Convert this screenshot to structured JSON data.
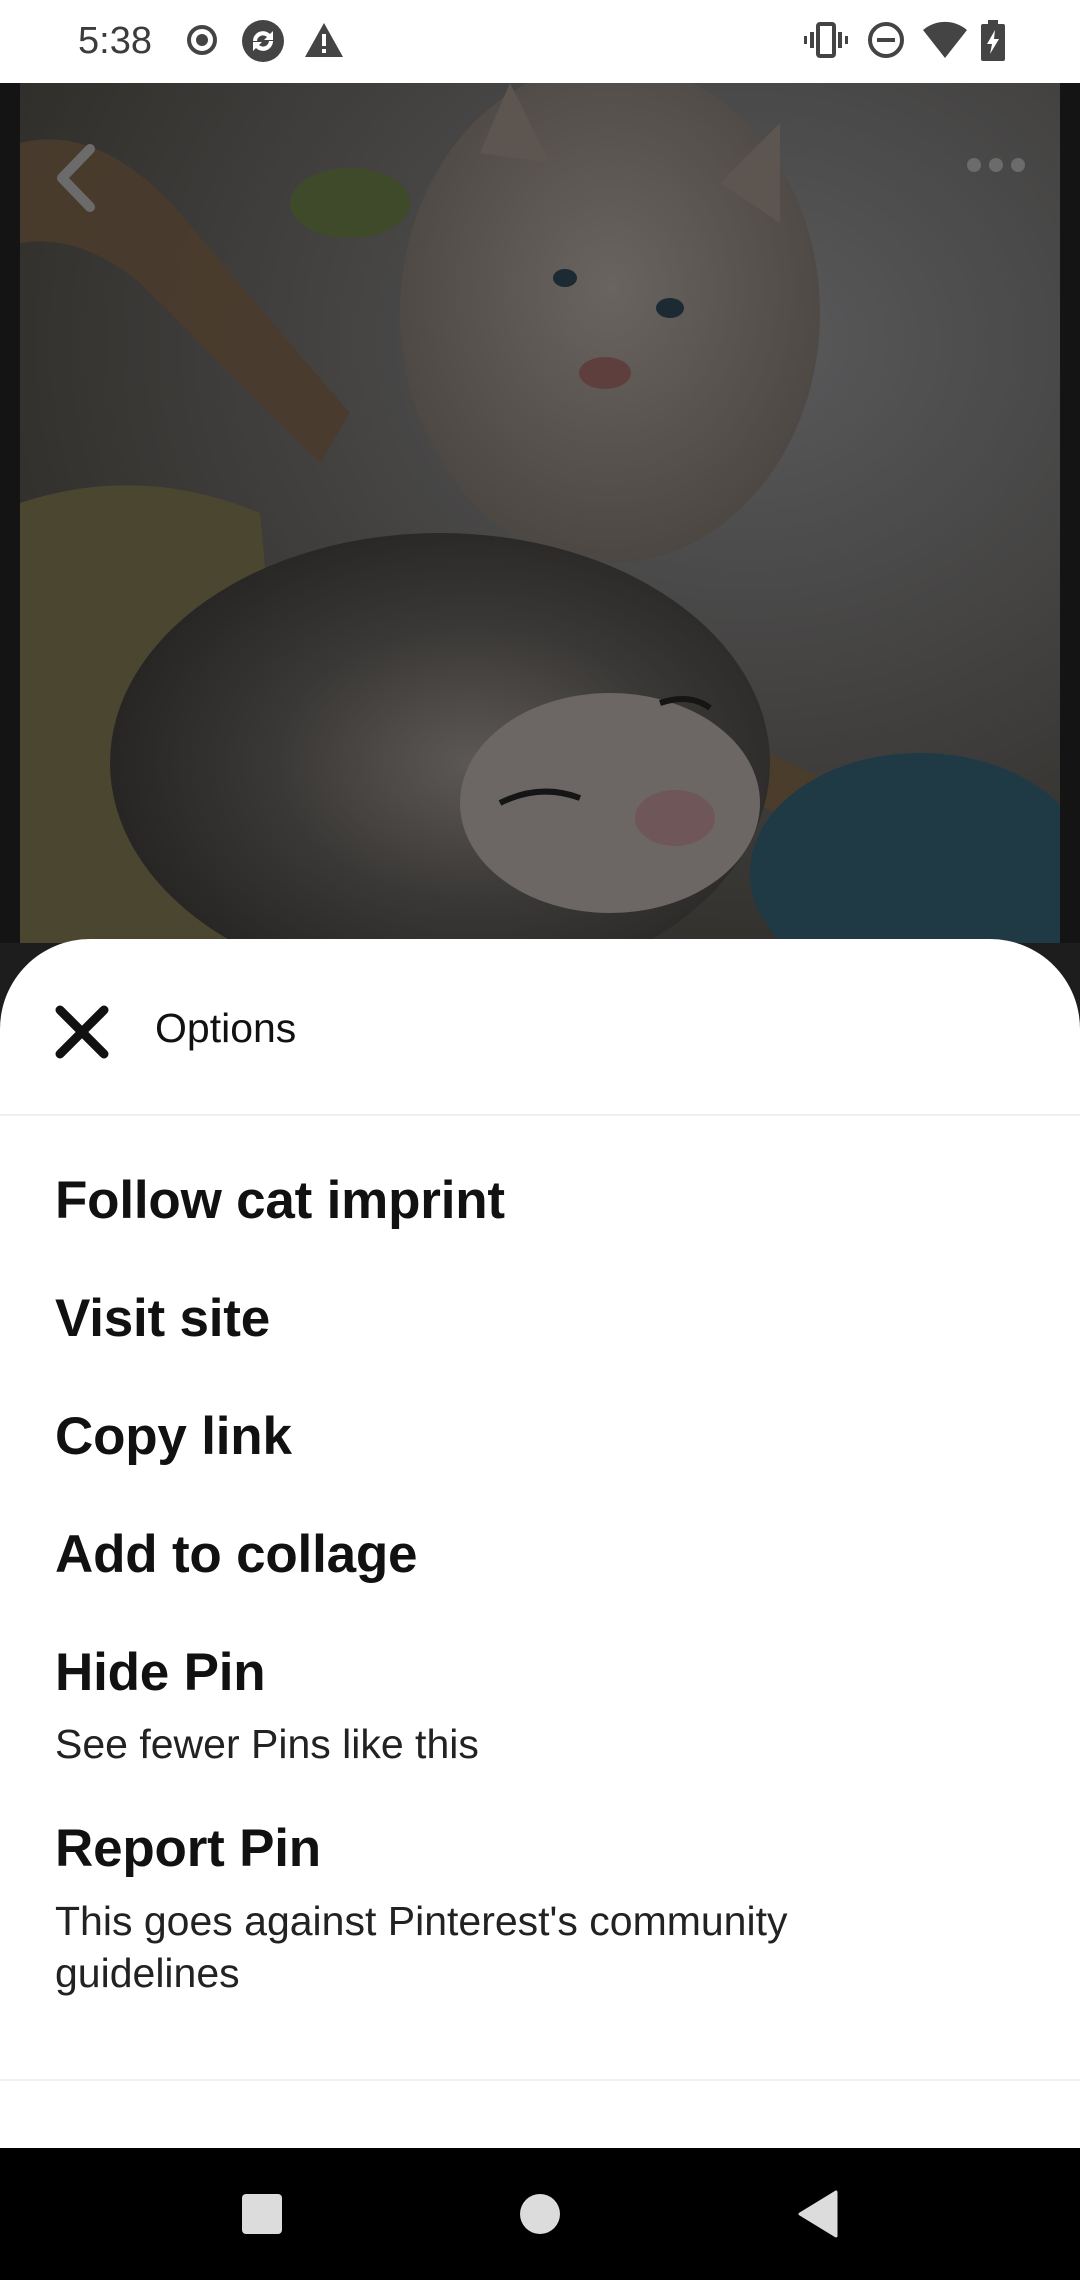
{
  "status_bar": {
    "time": "5:38",
    "left_icons": [
      "record-icon",
      "sync-icon",
      "warning-icon"
    ],
    "right_icons": [
      "vibrate-icon",
      "do-not-disturb-icon",
      "wifi-icon",
      "battery-charging-icon"
    ]
  },
  "pin": {
    "back_icon": "chevron-left-icon",
    "more_icon": "more-horizontal-icon"
  },
  "sheet": {
    "title": "Options",
    "close_icon": "close-icon",
    "items": [
      {
        "label": "Follow cat imprint"
      },
      {
        "label": "Visit site"
      },
      {
        "label": "Copy link"
      },
      {
        "label": "Add to collage"
      },
      {
        "label": "Hide Pin",
        "sub": "See fewer Pins like this"
      },
      {
        "label": "Report Pin",
        "sub": "This goes against Pinterest's community guidelines"
      }
    ]
  },
  "nav_bar": {
    "buttons": [
      "recents-square-icon",
      "home-circle-icon",
      "back-triangle-icon"
    ]
  },
  "colors": {
    "sheet_bg": "#ffffff",
    "text": "#111111",
    "scrim": "#1d1d1d",
    "nav_bg": "#000000"
  }
}
